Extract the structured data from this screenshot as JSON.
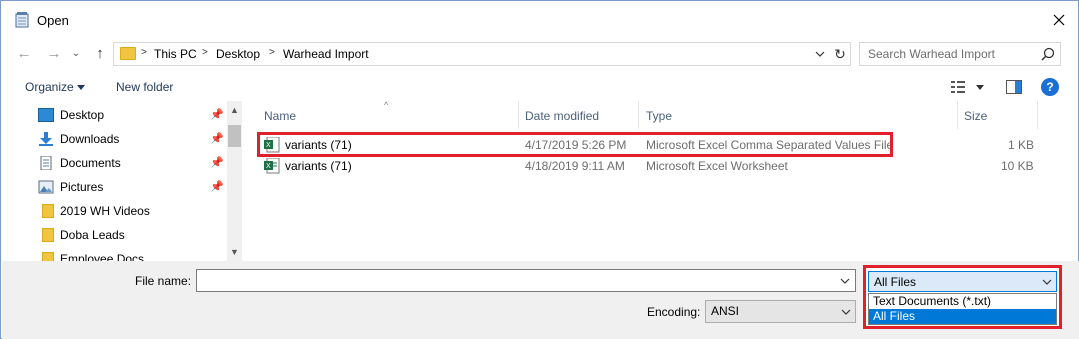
{
  "window": {
    "title": "Open"
  },
  "address": {
    "crumbs": [
      "This PC",
      "Desktop",
      "Warhead Import"
    ],
    "search_placeholder": "Search Warhead Import"
  },
  "toolbar": {
    "organize": "Organize",
    "new_folder": "New folder"
  },
  "sidebar": {
    "items": [
      {
        "label": "Desktop",
        "icon": "desktop-icon",
        "pinned": true
      },
      {
        "label": "Downloads",
        "icon": "downloads-icon",
        "pinned": true
      },
      {
        "label": "Documents",
        "icon": "documents-icon",
        "pinned": true
      },
      {
        "label": "Pictures",
        "icon": "pictures-icon",
        "pinned": true
      },
      {
        "label": "2019 WH Videos",
        "icon": "folder-icon",
        "pinned": false
      },
      {
        "label": "Doba Leads",
        "icon": "folder-icon",
        "pinned": false
      },
      {
        "label": "Employee Docs",
        "icon": "folder-icon",
        "pinned": false
      }
    ]
  },
  "files": {
    "columns": {
      "name": "Name",
      "date": "Date modified",
      "type": "Type",
      "size": "Size"
    },
    "rows": [
      {
        "name": "variants (71)",
        "date": "4/17/2019 5:26 PM",
        "type": "Microsoft Excel Comma Separated Values File",
        "size": "1 KB",
        "icon": "csv-icon"
      },
      {
        "name": "variants (71)",
        "date": "4/18/2019 9:11 AM",
        "type": "Microsoft Excel Worksheet",
        "size": "10 KB",
        "icon": "excel-icon"
      }
    ]
  },
  "bottom": {
    "file_name_label": "File name:",
    "file_name_value": "",
    "encoding_label": "Encoding:",
    "encoding_value": "ANSI",
    "filter_value": "All Files",
    "filter_options": [
      "Text Documents (*.txt)",
      "All Files"
    ]
  },
  "colors": {
    "highlight": "#e0202a",
    "selection": "#0078d7",
    "folder": "#f0c53f"
  }
}
